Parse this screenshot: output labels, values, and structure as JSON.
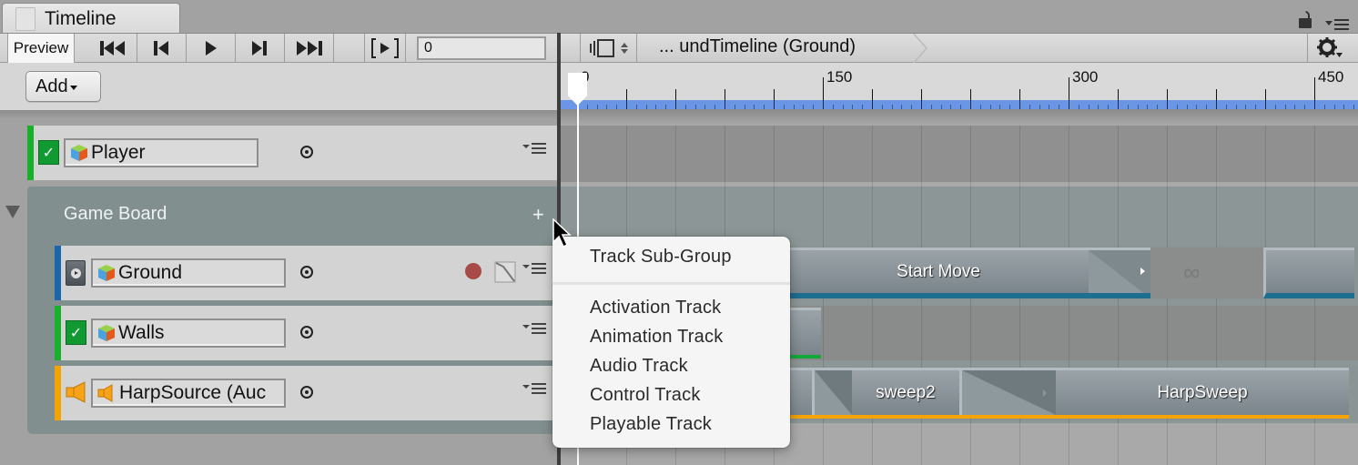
{
  "window": {
    "tab_title": "Timeline",
    "icons": [
      "window-tab-icon",
      "lock-icon",
      "window-menu-icon"
    ]
  },
  "toolbar": {
    "preview_label": "Preview",
    "buttons": [
      {
        "name": "jump-to-start",
        "glyph": "⏮"
      },
      {
        "name": "previous-frame",
        "glyph": "⏴"
      },
      {
        "name": "play",
        "glyph": "▶"
      },
      {
        "name": "next-frame",
        "glyph": "⏵"
      },
      {
        "name": "jump-to-end",
        "glyph": "⏭"
      },
      {
        "name": "play-range",
        "glyph": "[▶]"
      }
    ],
    "frame_value": "0",
    "add_label": "Add"
  },
  "right_toolbar": {
    "breadcrumb": "... undTimeline (Ground)",
    "icons": [
      "clip-edit-mode-icon",
      "settings-gear-icon"
    ]
  },
  "ruler": {
    "labels": [
      "0",
      "150",
      "300",
      "450"
    ],
    "major_every_frames": 150,
    "minor_every_frames": 30,
    "playhead_frame": 0
  },
  "tracks": {
    "player": {
      "name": "Player",
      "color": "#17b02b",
      "type": "activation",
      "enabled": true
    },
    "group": {
      "name": "Game Board",
      "add_icon": "+"
    },
    "ground": {
      "name": "Ground",
      "color": "#1966a8",
      "type": "animation"
    },
    "walls": {
      "name": "Walls",
      "color": "#17b02b",
      "type": "activation",
      "enabled": true
    },
    "harp": {
      "name": "HarpSource (Auc",
      "color": "#f5a300",
      "type": "audio"
    }
  },
  "clips": {
    "start_move": "Start Move",
    "sweep2": "sweep2",
    "harp_sweep": "HarpSweep",
    "infinite_icon": "∞"
  },
  "context_menu": {
    "items": [
      "Track Sub-Group",
      "Activation Track",
      "Animation Track",
      "Audio Track",
      "Control Track",
      "Playable Track"
    ]
  }
}
